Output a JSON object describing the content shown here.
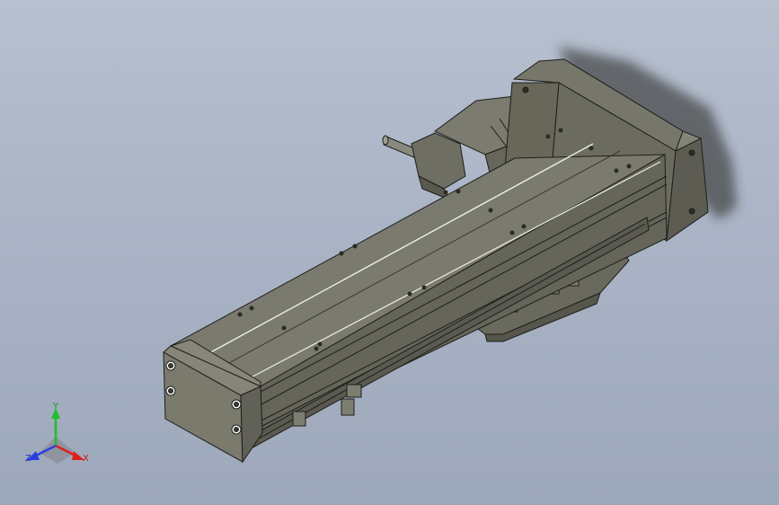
{
  "viewport": {
    "background": "#aab4c6",
    "model_color": "#6f6e63",
    "edge_color": "#1e1e1a"
  },
  "triad": {
    "x_label": "X",
    "y_label": "Y",
    "z_label": "Z",
    "x_color": "#e0201c",
    "y_color": "#1fbf2a",
    "z_color": "#2a3fe0"
  }
}
